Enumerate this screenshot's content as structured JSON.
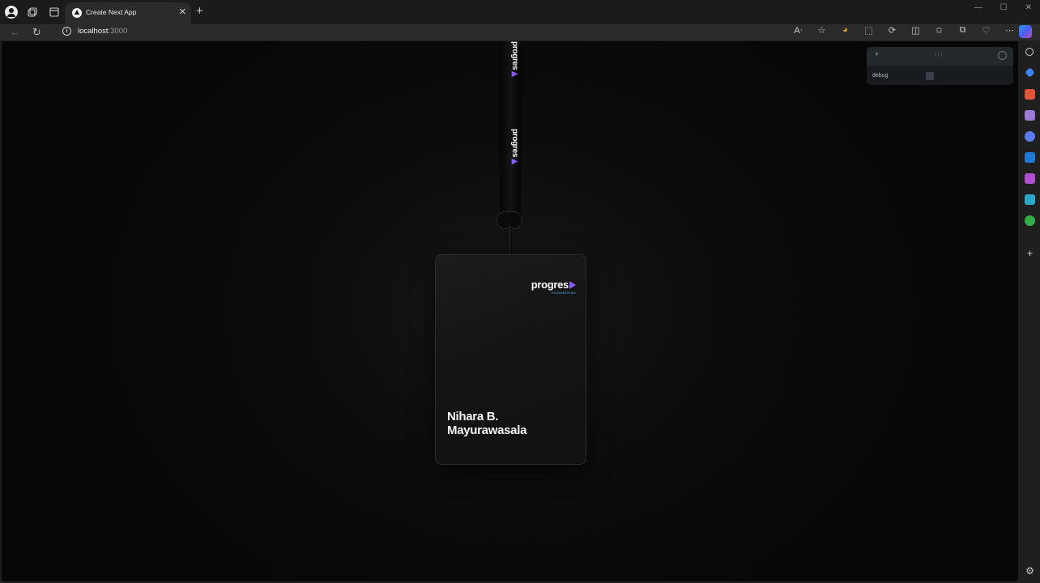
{
  "tab": {
    "title": "Create Next App",
    "close": "✕",
    "new_tab": "+"
  },
  "window_controls": {
    "minimize": "—",
    "maximize": "☐",
    "close": "✕"
  },
  "address_bar": {
    "host": "localhost",
    "port": ":3000"
  },
  "strap": {
    "brand_word": "progres",
    "brand_accent": "▶"
  },
  "badge": {
    "logo_word": "progres",
    "logo_sub": "ENGINEERING",
    "name_line1": "Nihara B.",
    "name_line2": "Mayurawasala"
  },
  "debug_panel": {
    "label": "debug",
    "checked": false
  },
  "colors": {
    "accent_purple": "#8b5cf6",
    "accent_blue": "#4fc0ff",
    "background": "#0d0d0d"
  },
  "icons": {
    "titlebar": [
      "profile-icon",
      "workspaces-icon",
      "tab-actions-icon"
    ],
    "toolbar": [
      "read-aloud-icon",
      "favorites-star-icon",
      "color-wheel-extension-icon",
      "screenshot-icon",
      "refresh-extension-icon",
      "split-screen-icon",
      "favorites-icon",
      "collections-icon",
      "health-icon",
      "more-icon",
      "copilot-icon"
    ],
    "sidebar": [
      "search-icon",
      "shopping-icon",
      "tools-icon",
      "games-icon",
      "copilot-sidebar-icon",
      "outlook-icon",
      "designer-icon",
      "telegram-icon",
      "tree-icon",
      "add-icon",
      "settings-icon"
    ]
  }
}
